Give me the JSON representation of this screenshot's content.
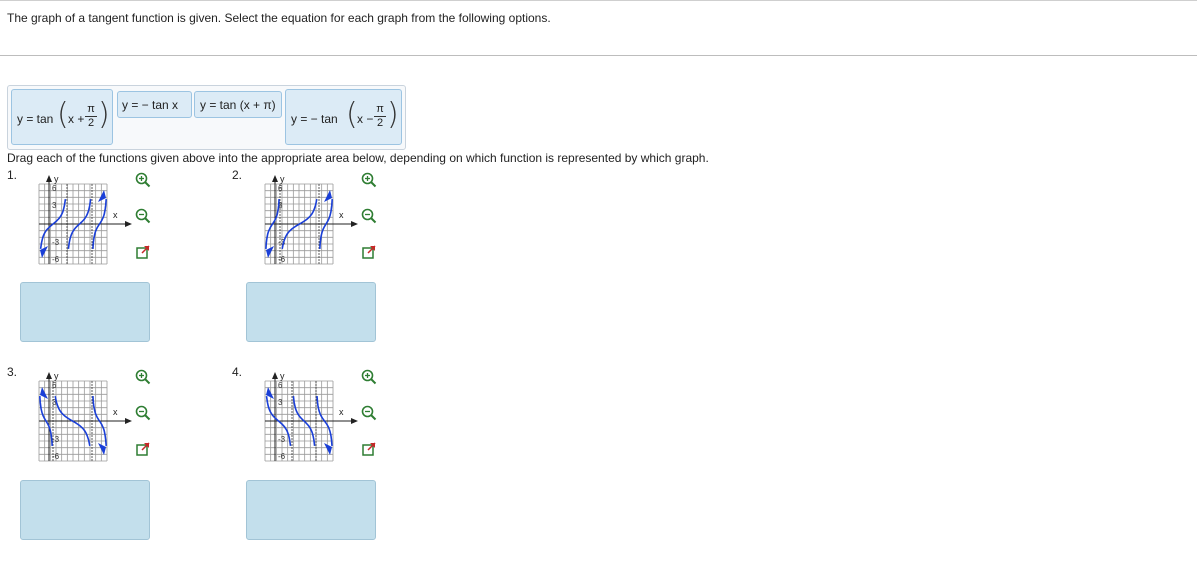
{
  "instruction": "The graph of a tangent function is given. Select the equation for each graph from the following options.",
  "options": {
    "opt1": {
      "pre": "y = tan",
      "inner": "x +",
      "num": "π",
      "den": "2"
    },
    "opt2": {
      "text": "y = − tan x"
    },
    "opt3": {
      "text": "y = tan (x + π)"
    },
    "opt4": {
      "pre": "y = − tan",
      "inner": "x −",
      "num": "π",
      "den": "2"
    }
  },
  "drag_prompt": "Drag each of the functions given above into the appropriate area below, depending on which function is represented by which graph.",
  "graphs": [
    {
      "number": "1.",
      "axis_x": "x",
      "axis_y": "y",
      "tick_top": "6",
      "tick_mid": "3",
      "tick_neg_mid": "-3",
      "tick_bottom": "-6"
    },
    {
      "number": "2.",
      "axis_x": "x",
      "axis_y": "y",
      "tick_top": "6",
      "tick_mid": "3",
      "tick_neg_mid": "-3",
      "tick_bottom": "-6"
    },
    {
      "number": "3.",
      "axis_x": "x",
      "axis_y": "y",
      "tick_top": "6",
      "tick_mid": "3",
      "tick_neg_mid": "-3",
      "tick_bottom": "-6"
    },
    {
      "number": "4.",
      "axis_x": "x",
      "axis_y": "y",
      "tick_top": "6",
      "tick_mid": "3",
      "tick_neg_mid": "-3",
      "tick_bottom": "-6"
    }
  ],
  "colors": {
    "curve": "#1a3fd8",
    "drop_zone": "#c3dfec",
    "tile": "#dcebf6"
  }
}
